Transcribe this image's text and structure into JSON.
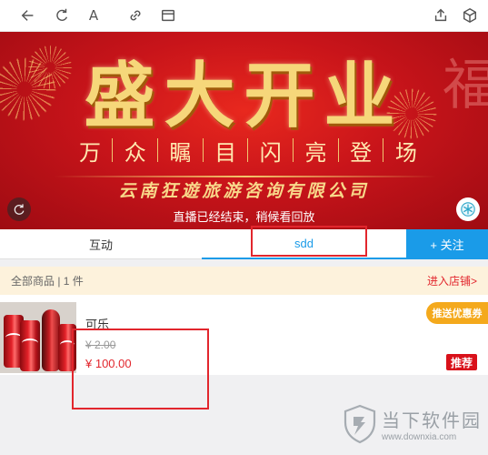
{
  "toolbar": {
    "format_icon_text": "A"
  },
  "banner": {
    "title": "盛大开业",
    "slogan": [
      "万",
      "众",
      "瞩",
      "目",
      "闪",
      "亮",
      "登",
      "场"
    ],
    "company": "云南狂遊旅游咨询有限公司",
    "status_text": "直播已经结束，稍候看回放",
    "side_deco": "福"
  },
  "tabs": {
    "interact": "互动",
    "sdd": "sdd",
    "follow": "+ 关注"
  },
  "shop": {
    "count_text": "全部商品 | 1 件",
    "link_text": "进入店铺>"
  },
  "product": {
    "name": "可乐",
    "old_price": "¥ 2.00",
    "new_price": "¥ 100.00",
    "coupon": "推送优惠券",
    "recommend": "推荐"
  },
  "watermark": {
    "title": "当下软件园",
    "url": "www.downxia.com"
  },
  "colors": {
    "accent": "#1a9be8",
    "highlight_box": "#e2262d",
    "price": "#e2262d",
    "coupon": "#f4a91c",
    "banner_red": "#c8141a"
  }
}
